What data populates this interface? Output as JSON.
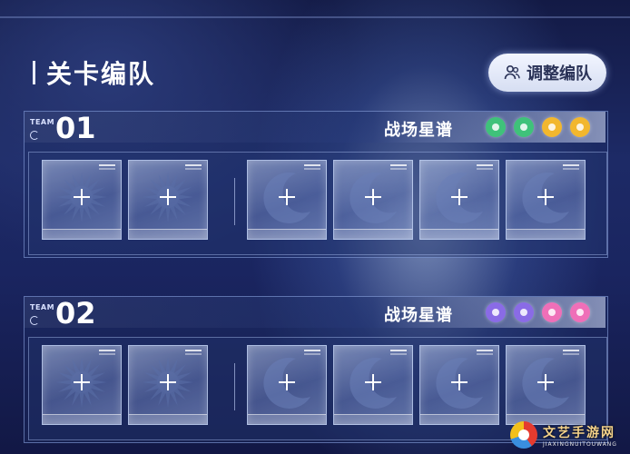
{
  "header": {
    "title": "关卡编队",
    "adjust_button_label": "调整编队"
  },
  "teams": [
    {
      "tag": "TEAM",
      "number": "01",
      "stage_name": "战场星谱",
      "dot_colors": [
        "#3fc27a",
        "#3fc27a",
        "#f2b72e",
        "#f2b72e"
      ],
      "left_slots": [
        "sun",
        "sun"
      ],
      "right_slots": [
        "moon",
        "moon",
        "moon",
        "moon"
      ]
    },
    {
      "tag": "TEAM",
      "number": "02",
      "stage_name": "战场星谱",
      "dot_colors": [
        "#8a6be6",
        "#8a6be6",
        "#ef6fb8",
        "#ef6fb8"
      ],
      "left_slots": [
        "sun",
        "sun"
      ],
      "right_slots": [
        "moon",
        "moon",
        "moon",
        "moon"
      ]
    }
  ],
  "watermark": {
    "text": "文艺手游网",
    "sub": "JIAXINGNUITOUWANG"
  }
}
